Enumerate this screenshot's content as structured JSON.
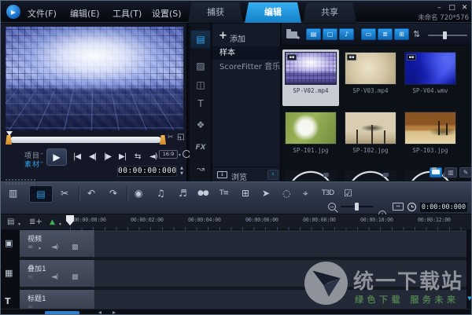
{
  "colors": {
    "accent": "#1e96e8",
    "selection_light": "#c8ccd4",
    "watermark_green": "#4f7d4f"
  },
  "window": {
    "menus": [
      "文件(F)",
      "编辑(E)",
      "工具(T)",
      "设置(S)"
    ],
    "tabs": [
      "捕获",
      "编辑",
      "共享"
    ],
    "active_tab": "编辑",
    "project_info": "未命名 720*576",
    "controls": {
      "minimize": "–",
      "maximize": "□",
      "close": "✕"
    }
  },
  "preview": {
    "project_label": "项目",
    "clip_label": "素材",
    "aspect_label": "16:9",
    "timecode": "00:00:00:000",
    "spinner": {
      "up": "▲",
      "down": "▼"
    },
    "transport": [
      {
        "name": "play",
        "glyph": "▶"
      },
      {
        "name": "home",
        "glyph": "|◀"
      },
      {
        "name": "previous-frame",
        "glyph": "◀|"
      },
      {
        "name": "next-frame",
        "glyph": "|▶"
      },
      {
        "name": "end",
        "glyph": "▶|"
      },
      {
        "name": "repeat",
        "glyph": "⇆"
      },
      {
        "name": "volume",
        "glyph": "◄)"
      }
    ],
    "trim_icons": {
      "scissors": "✂",
      "enlarge": "◱"
    }
  },
  "nav_rail": {
    "items": [
      {
        "name": "media-library",
        "glyph": "▤",
        "active": true
      },
      {
        "name": "instant-project",
        "glyph": "▨"
      },
      {
        "name": "transition",
        "glyph": "◫"
      },
      {
        "name": "title",
        "glyph": "T"
      },
      {
        "name": "graphic",
        "glyph": "❖"
      },
      {
        "name": "filter-fx",
        "glyph": "FX"
      },
      {
        "name": "motion-path",
        "glyph": "↝"
      }
    ]
  },
  "gallery": {
    "add_label": "添加",
    "add_glyph": "+",
    "items": [
      {
        "label": "样本",
        "selected": true
      },
      {
        "label": "ScoreFitter 音乐",
        "selected": false
      }
    ],
    "browse_label": "浏览",
    "browse_glyph": "↓",
    "collapse_glyph": "‹"
  },
  "library": {
    "filters": [
      {
        "name": "show-videos",
        "glyph": "▤"
      },
      {
        "name": "show-photos",
        "glyph": "▢"
      },
      {
        "name": "show-audio",
        "glyph": "♪"
      }
    ],
    "views": [
      {
        "name": "show-titles",
        "glyph": "▭"
      },
      {
        "name": "list-view",
        "glyph": "≣"
      },
      {
        "name": "thumbnail-view",
        "glyph": "⊞"
      }
    ],
    "sort_glyph": "⇅",
    "badge_glyph": "▪▪",
    "items": [
      {
        "name": "SP-V02.mp4",
        "type": "video",
        "selected": true
      },
      {
        "name": "SP-V03.mp4",
        "type": "video",
        "selected": false
      },
      {
        "name": "SP-V04.wmv",
        "type": "video",
        "selected": false
      },
      {
        "name": "SP-I01.jpg",
        "type": "photo",
        "selected": false
      },
      {
        "name": "SP-I02.jpg",
        "type": "photo",
        "selected": false
      },
      {
        "name": "SP-I03.jpg",
        "type": "photo",
        "selected": false
      }
    ],
    "corner_buttons": [
      {
        "name": "import-folder",
        "glyph": ""
      },
      {
        "name": "smart-package",
        "glyph": "▥"
      },
      {
        "name": "edit-info",
        "glyph": "✎"
      }
    ]
  },
  "timeline": {
    "toolbar": [
      {
        "name": "storyboard-view",
        "glyph": "▥"
      },
      {
        "name": "timeline-view",
        "glyph": "▤",
        "active": true
      },
      {
        "name": "editing-toolbox",
        "glyph": "✂"
      },
      {
        "name": "undo",
        "glyph": "↶"
      },
      {
        "name": "redo",
        "glyph": "↷"
      },
      {
        "name": "record-capture",
        "glyph": "◉"
      },
      {
        "name": "sound-mixer",
        "glyph": "♫"
      },
      {
        "name": "auto-music",
        "glyph": "♬"
      },
      {
        "name": "painting-creator",
        "glyph": "●●"
      },
      {
        "name": "subtitle-editor",
        "glyph": "T≡"
      },
      {
        "name": "multi-camera",
        "glyph": "⊞"
      },
      {
        "name": "motion-tracking",
        "glyph": "➤"
      },
      {
        "name": "speed-remap",
        "glyph": "◌"
      },
      {
        "name": "track-motion",
        "glyph": "⌖"
      },
      {
        "name": "3d-title",
        "glyph": "T3D"
      },
      {
        "name": "mask-creator",
        "glyph": "☑"
      }
    ],
    "zoom_controls": {
      "out": "−",
      "in": "+"
    },
    "zoom_timecode": "0:00:00:000",
    "ruler_icons": {
      "track-film": "▤",
      "track-list": "≣+",
      "marker": "▲",
      "caret": "▾"
    },
    "ruler_ticks": [
      "00:00:00:00",
      "00:00:02:00",
      "00:00:04:00",
      "00:00:06:00",
      "00:00:08:00",
      "00:00:10:00",
      "00:00:12:00"
    ],
    "tracks": [
      {
        "label": "视频",
        "type": "video"
      },
      {
        "label": "叠加1",
        "type": "overlay"
      },
      {
        "label": "标题1",
        "type": "title"
      }
    ],
    "track_icons": {
      "video": "▣",
      "overlay": "▦",
      "title": "T",
      "link": "∞",
      "mute": "◄)",
      "transparency": "▩",
      "caret": "▾"
    },
    "scroll": {
      "left": "◂",
      "right": "▸",
      "down": "▼"
    }
  },
  "watermark": {
    "title": "统一下载站",
    "subtitle": "绿色下载  服务未来"
  }
}
